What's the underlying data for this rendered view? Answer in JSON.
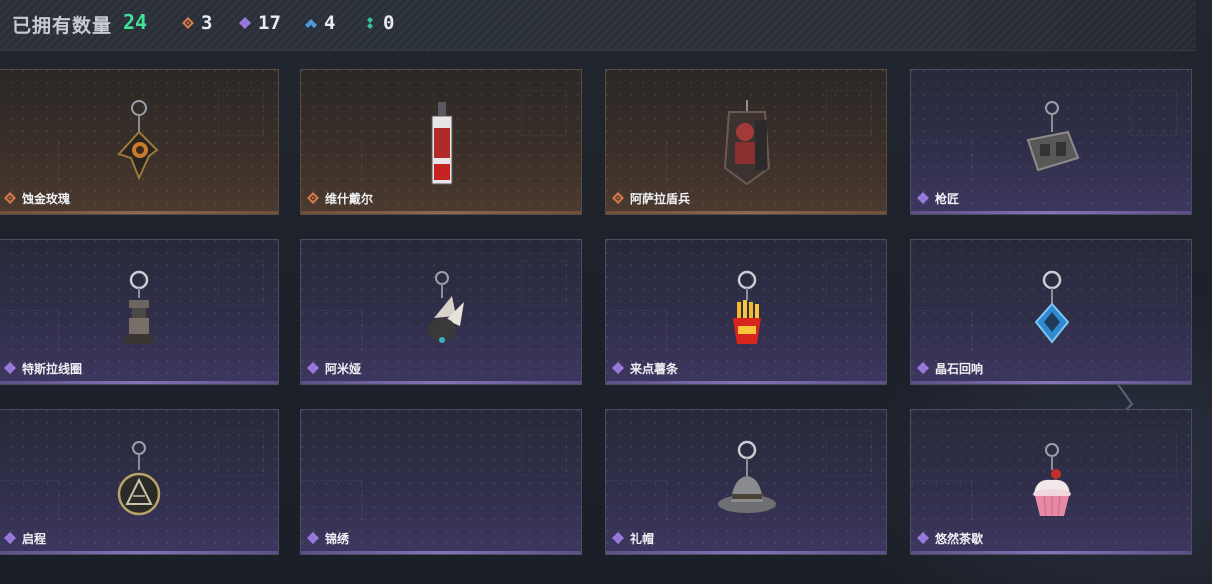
{
  "header": {
    "title": "已拥有数量",
    "total": "24",
    "stats": [
      {
        "icon": "orange-diamond-icon",
        "color": "#d77a4a",
        "count": "3"
      },
      {
        "icon": "purple-diamond-icon",
        "color": "#9b7ae0",
        "count": "17"
      },
      {
        "icon": "blue-diamond-icon",
        "color": "#4d9be0",
        "count": "4"
      },
      {
        "icon": "green-diamond-icon",
        "color": "#36c79a",
        "count": "0"
      }
    ]
  },
  "items": [
    {
      "name": "蚀金玫瑰",
      "rarity": "gold",
      "icon": "gold-rose-charm-icon"
    },
    {
      "name": "维什戴尔",
      "rarity": "gold",
      "icon": "red-vial-charm-icon"
    },
    {
      "name": "阿萨拉盾兵",
      "rarity": "gold",
      "icon": "shield-soldier-charm-icon"
    },
    {
      "name": "枪匠",
      "rarity": "purple",
      "icon": "gunsmith-tag-charm-icon"
    },
    {
      "name": "特斯拉线圈",
      "rarity": "purple",
      "icon": "tesla-coil-charm-icon"
    },
    {
      "name": "阿米娅",
      "rarity": "purple",
      "icon": "amiya-charm-icon"
    },
    {
      "name": "来点薯条",
      "rarity": "purple",
      "icon": "fries-charm-icon"
    },
    {
      "name": "晶石回响",
      "rarity": "purple",
      "icon": "crystal-echo-charm-icon"
    },
    {
      "name": "启程",
      "rarity": "purple",
      "icon": "medallion-charm-icon"
    },
    {
      "name": "锦绣",
      "rarity": "purple",
      "icon": "empty-charm-icon"
    },
    {
      "name": "礼帽",
      "rarity": "purple",
      "icon": "fedora-charm-icon"
    },
    {
      "name": "悠然茶歇",
      "rarity": "purple",
      "icon": "cupcake-charm-icon"
    }
  ],
  "colors": {
    "gold": "#d77a4a",
    "purple": "#9b7ae0",
    "total_green": "#3fe29a"
  }
}
